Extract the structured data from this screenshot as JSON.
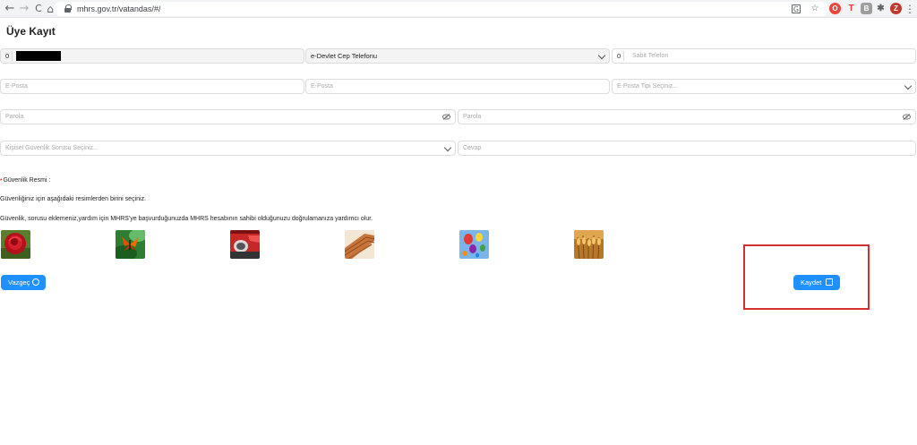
{
  "browser": {
    "url": "mhrs.gov.tr/vatandas/#/",
    "back_icon": "←",
    "forward_icon": "→",
    "reload_icon": "C",
    "home_icon": "⌂",
    "star_icon": "☆",
    "menu_icon": "⋮",
    "profile_letter": "Z"
  },
  "page": {
    "title": "Üye Kayıt"
  },
  "form": {
    "phone_prefix": "0",
    "phone_type": "e-Devlet Cep Telefonu",
    "landline_prefix": "0",
    "landline_placeholder": "Sabit Telefon",
    "email_placeholder": "E-Posta",
    "email_confirm_placeholder": "E-Posta",
    "email_type_placeholder": "E-Posta Tipi Seçiniz...",
    "password_placeholder": "Parola",
    "password_confirm_placeholder": "Parola",
    "security_question_placeholder": "Kişisel Güvenlik Sorusu Seçiniz...",
    "answer_placeholder": "Cevap"
  },
  "security": {
    "required_mark": "•",
    "label": "Güvenlik Resmi :",
    "instruction": "Güvenliğiniz için aşağıdaki resimlerden birini seçiniz.",
    "note": "Güvenlik, sorusu eklemeniz,yardım için MHRS'ye başvurduğunuzda MHRS hesabının sahibi olduğunuzu doğrulamanıza yardımcı olur."
  },
  "images": [
    {
      "name": "rose-image"
    },
    {
      "name": "butterfly-image"
    },
    {
      "name": "red-car-image"
    },
    {
      "name": "wood-planks-image"
    },
    {
      "name": "hot-air-balloons-image"
    },
    {
      "name": "wheat-image"
    }
  ],
  "buttons": {
    "cancel_label": "Vazgeç",
    "save_label": "Kaydet"
  },
  "colors": {
    "primary": "#1e90ff",
    "highlight": "#d32f2f"
  }
}
